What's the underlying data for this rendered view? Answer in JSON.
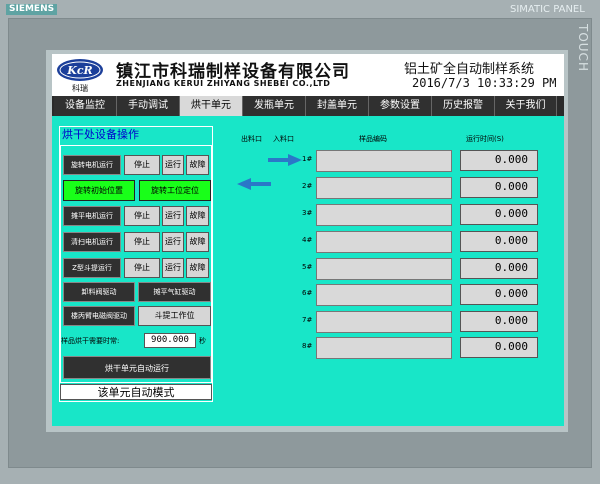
{
  "bezel": {
    "brand": "SIEMENS",
    "panel": "SIMATIC PANEL",
    "touch": "TOUCH"
  },
  "header": {
    "logo_text": "KcR",
    "logo_sub": "科瑞",
    "company_cn": "镇江市科瑞制样设备有限公司",
    "company_en": "ZHENJIANG KERUI ZHIYANG SHEBEI CO.,LTD",
    "system_title": "铝土矿全自动制样系统",
    "datetime": "2016/7/3  10:33:29 PM"
  },
  "nav": {
    "items": [
      "设备监控",
      "手动调试",
      "烘干单元",
      "发瓶单元",
      "封盖单元",
      "参数设置",
      "历史报警",
      "关于我们"
    ],
    "active_index": 2
  },
  "process": {
    "title": "烘干处设备操作",
    "rows": [
      {
        "label": "旋转电机运行",
        "stop": "停止",
        "run": "运行",
        "fault": "故障"
      },
      {
        "label": "摊平电机运行",
        "stop": "停止",
        "run": "运行",
        "fault": "故障"
      },
      {
        "label": "清扫电机运行",
        "stop": "停止",
        "run": "运行",
        "fault": "故障"
      },
      {
        "label": "Z型斗提运行",
        "stop": "停止",
        "run": "运行",
        "fault": "故障"
      }
    ],
    "rotate_init": "旋转初始位置",
    "rotate_work": "旋转工位定位",
    "unload_valve": "卸料阀驱动",
    "flatten_cyl": "摊平气缸驱动",
    "mech_arm_valve": "楼丙臂电磁阀驱动",
    "bucket_pos": "斗提工作位",
    "drying_label": "样品烘干需要时常:",
    "drying_value": "900.000",
    "drying_unit": "秒",
    "auto_run": "烘干单元自动运行",
    "mode": "该单元自动模式"
  },
  "slots": {
    "header_out": "出料口",
    "header_in": "入料口",
    "header_code": "样品编码",
    "header_time": "运行时间(S)",
    "items": [
      {
        "no": "1#",
        "time": "0.000"
      },
      {
        "no": "2#",
        "time": "0.000"
      },
      {
        "no": "3#",
        "time": "0.000"
      },
      {
        "no": "4#",
        "time": "0.000"
      },
      {
        "no": "5#",
        "time": "0.000"
      },
      {
        "no": "6#",
        "time": "0.000"
      },
      {
        "no": "7#",
        "time": "0.000"
      },
      {
        "no": "8#",
        "time": "0.000"
      }
    ]
  },
  "colors": {
    "screen_bg": "#18e6c8",
    "active_green": "#19ff19",
    "arrow_blue": "#2a78c8"
  }
}
